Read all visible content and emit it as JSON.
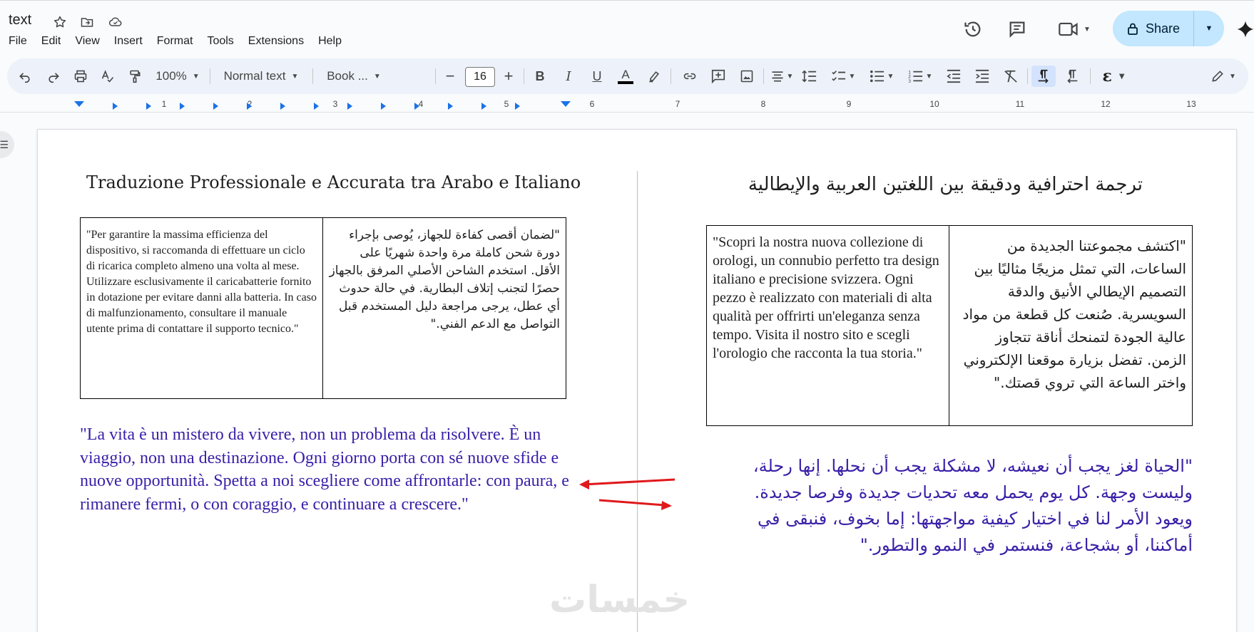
{
  "doc": {
    "title": "text"
  },
  "menu": [
    "File",
    "Edit",
    "View",
    "Insert",
    "Format",
    "Tools",
    "Extensions",
    "Help"
  ],
  "header": {
    "share_label": "Share"
  },
  "toolbar": {
    "zoom": "100%",
    "style": "Normal text",
    "font": "Book ...",
    "font_size": "16"
  },
  "ruler": {
    "numbers": [
      "1",
      "2",
      "3",
      "4",
      "5",
      "6",
      "7",
      "8",
      "9",
      "10",
      "11",
      "12",
      "13"
    ]
  },
  "content": {
    "heading_italian": "Traduzione Professionale e Accurata tra Arabo e Italiano",
    "heading_arabic": "ترجمة احترافية ودقيقة بين اللغتين العربية والإيطالية",
    "table1_italian": "\"Per garantire la massima efficienza del dispositivo, si raccomanda di effettuare un ciclo di ricarica completo almeno una volta al mese. Utilizzare esclusivamente il caricabatterie fornito in dotazione per evitare danni alla batteria. In caso di malfunzionamento, consultare il manuale utente prima di contattare il supporto tecnico.\"",
    "table1_arabic": "\"لضمان أقصى كفاءة للجهاز، يُوصى بإجراء دورة شحن كاملة مرة واحدة شهريًا على الأقل. استخدم الشاحن الأصلي المرفق بالجهاز حصرًا لتجنب إتلاف البطارية. في حالة حدوث أي عطل، يرجى مراجعة دليل المستخدم قبل التواصل مع الدعم الفني.\"",
    "table2_italian": "\"Scopri la nostra nuova collezione di orologi, un connubio perfetto tra design italiano e precisione svizzera. Ogni pezzo è realizzato con materiali di alta qualità per offrirti un'eleganza senza tempo. Visita il nostro sito e scegli l'orologio che racconta la tua storia.\"",
    "table2_arabic": "\"اكتشف مجموعتنا الجديدة من الساعات، التي تمثل مزيجًا مثاليًا بين التصميم الإيطالي الأنيق والدقة السويسرية. صُنعت كل قطعة من مواد عالية الجودة لتمنحك أناقة تتجاوز الزمن. تفضل بزيارة موقعنا الإلكتروني واختر الساعة التي تروي قصتك.\"",
    "quote_italian": "\"La vita è un mistero da vivere, non un problema da risolvere. È un viaggio, non una destinazione. Ogni giorno porta con sé nuove sfide e nuove opportunità. Spetta a noi scegliere come affrontarle: con paura, e rimanere fermi, o con coraggio, e continuare a crescere.\"",
    "quote_arabic": "\"الحياة لغز يجب أن نعيشه، لا مشكلة يجب أن نحلها. إنها رحلة، وليست وجهة. كل يوم يحمل معه تحديات جديدة وفرصا جديدة. ويعود الأمر لنا في اختيار كيفية مواجهتها: إما بخوف، فنبقى في أماكننا، أو بشجاعة، فنستمر في النمو والتطور.\"",
    "watermark": "خمسات"
  },
  "colors": {
    "quote_text": "#3a20a8",
    "share_bg": "#c2e7ff",
    "arrow": "#e0191c",
    "accent": "#1a73e8"
  },
  "icons": {
    "title_bar": [
      "star-icon",
      "move-to-folder-icon",
      "cloud-saved-icon"
    ],
    "header": [
      "version-history-icon",
      "comments-icon",
      "meet-icon",
      "lock-icon",
      "gemini-icon"
    ]
  }
}
